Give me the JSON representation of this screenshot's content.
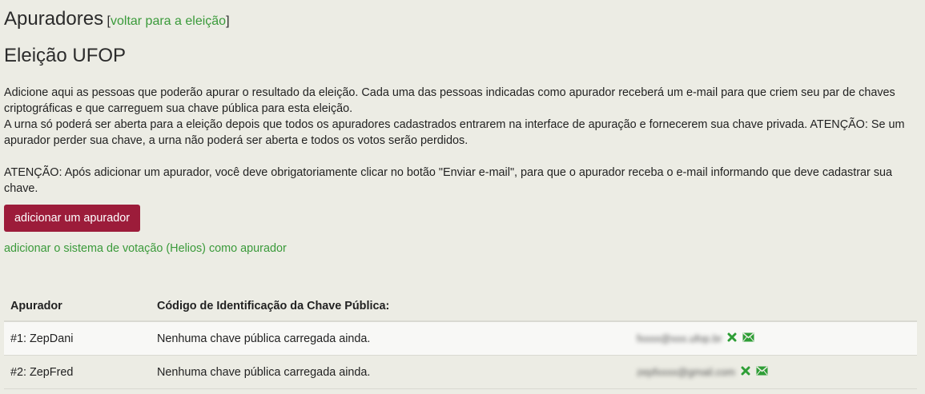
{
  "header": {
    "title": "Apuradores",
    "bracket_open": "[",
    "back_link": "voltar para a eleição",
    "bracket_close": "]"
  },
  "election_title": "Eleição UFOP",
  "intro": {
    "p1": "Adicione aqui as pessoas que poderão apurar o resultado da eleição. Cada uma das pessoas indicadas como apurador receberá um e-mail para que criem seu par de chaves criptográficas e que carreguem sua chave pública para esta eleição.",
    "p2": "A urna só poderá ser aberta para a eleição depois que todos os apuradores cadastrados entrarem na interface de apuração e fornecerem sua chave privada. ATENÇÃO: Se um apurador perder sua chave, a urna não poderá ser aberta e todos os votos serão perdidos.",
    "p3": "ATENÇÃO: Após adicionar um apurador, você deve obrigatoriamente clicar no botão \"Enviar e-mail\", para que o apurador receba o e-mail informando que deve cadastrar sua chave."
  },
  "add_button_label": "adicionar um apurador",
  "helios_link": "adicionar o sistema de votação (Helios) como apurador",
  "table": {
    "headers": [
      "Apurador",
      "Código de Identificação da Chave Pública:",
      ""
    ],
    "rows": [
      {
        "name": "#1: ZepDani",
        "key_status": "Nenhuma chave pública carregada ainda.",
        "email": "fxxxx@xxx.ufop.br"
      },
      {
        "name": "#2: ZepFred",
        "key_status": "Nenhuma chave pública carregada ainda.",
        "email": "zepfxxxx@gmail.com"
      }
    ]
  },
  "colors": {
    "accent_button": "#9c1c3a",
    "link": "#3a9a3a",
    "icon_green": "#2e9e36"
  },
  "icons": [
    "delete-x-icon",
    "envelope-icon"
  ]
}
